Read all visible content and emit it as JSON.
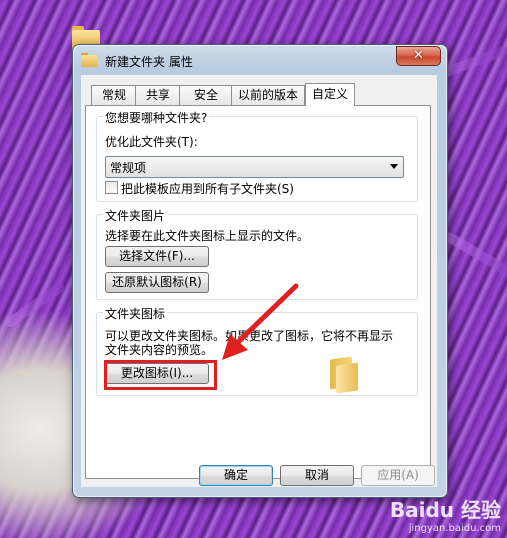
{
  "desktop": {
    "icon1": "folder-icon",
    "icon2": "folder-icon"
  },
  "window": {
    "title": "新建文件夹 属性",
    "close_label": "✕",
    "tabs": [
      "常规",
      "共享",
      "安全",
      "以前的版本",
      "自定义"
    ],
    "active_tab": "自定义"
  },
  "customize": {
    "group1": {
      "label": "您想要哪种文件夹?",
      "optimize_label": "优化此文件夹(T):",
      "optimize_value": "常规项",
      "apply_template_label": "把此模板应用到所有子文件夹(S)",
      "apply_template_checked": false
    },
    "group2": {
      "label": "文件夹图片",
      "description": "选择要在此文件夹图标上显示的文件。",
      "choose_file_button": "选择文件(F)...",
      "restore_default_button": "还原默认图标(R)"
    },
    "group3": {
      "label": "文件夹图标",
      "description_line1": "可以更改文件夹图标。如果更改了图标，它将不再显示",
      "description_line2": "文件夹内容的预览。",
      "change_icon_button": "更改图标(I)..."
    }
  },
  "footer": {
    "ok_button": "确定",
    "cancel_button": "取消",
    "apply_button": "应用(A)"
  },
  "annotation": {
    "highlight_color": "#e02020"
  },
  "watermark": {
    "logo": "Baidu 经验",
    "url": "jingyan.baidu.com"
  }
}
